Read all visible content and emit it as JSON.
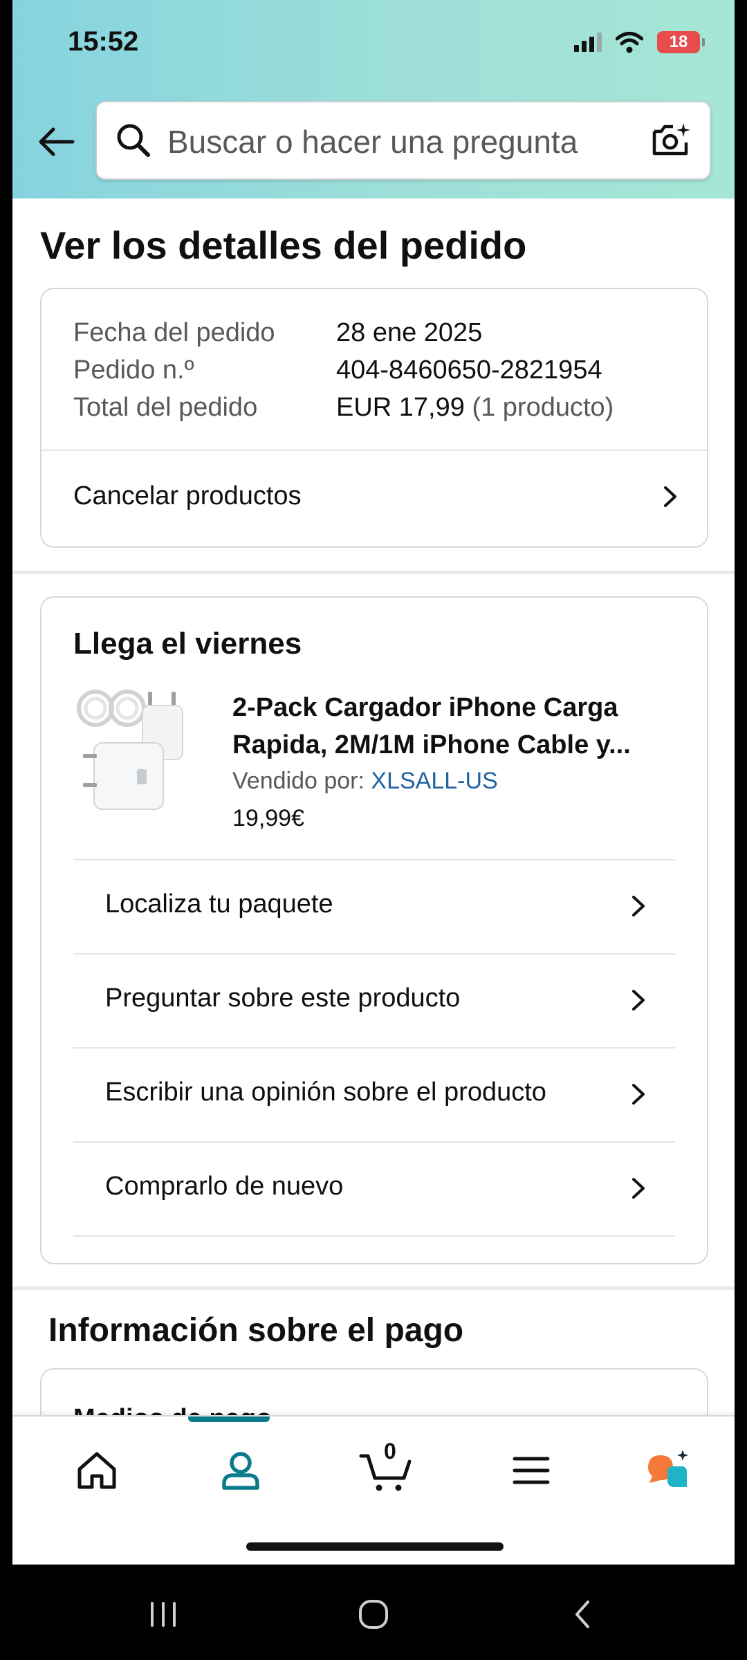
{
  "status_bar": {
    "time": "15:52",
    "battery": "18"
  },
  "search": {
    "placeholder": "Buscar o hacer una pregunta"
  },
  "page": {
    "title": "Ver los detalles del pedido"
  },
  "order_summary": {
    "rows": [
      {
        "label": "Fecha del pedido",
        "value": "28 ene 2025",
        "extra": ""
      },
      {
        "label": "Pedido n.º",
        "value": "404-8460650-2821954",
        "extra": ""
      },
      {
        "label": "Total del pedido",
        "value": "EUR 17,99",
        "extra": "(1 producto)"
      }
    ],
    "cancel_label": "Cancelar productos"
  },
  "delivery": {
    "title": "Llega el viernes",
    "product": {
      "title": "2-Pack Cargador iPhone Carga Rapida, 2M/1M iPhone Cable y...",
      "seller_prefix": "Vendido por:",
      "seller_name": "XLSALL-US",
      "price": "19,99€"
    },
    "actions": [
      {
        "label": "Localiza tu paquete"
      },
      {
        "label": "Preguntar sobre este producto"
      },
      {
        "label": "Escribir una opinión sobre el producto"
      },
      {
        "label": "Comprarlo de nuevo"
      }
    ]
  },
  "payment": {
    "title": "Información sobre el pago",
    "subtitle": "Medios de pago"
  },
  "bottom_nav": {
    "items": [
      "home-icon",
      "account-icon",
      "cart-icon",
      "menu-icon",
      "assistant-icon"
    ],
    "active": "account-icon",
    "cart_count": "0",
    "accent_color": "#0a7b8a"
  },
  "colors": {
    "header_gradient_start": "#86d3df",
    "header_gradient_end": "#a6e6d6",
    "link": "#2162a1",
    "battery": "#e94c4c",
    "assistant_orange": "#f5793b",
    "assistant_teal": "#1fb3c6"
  }
}
